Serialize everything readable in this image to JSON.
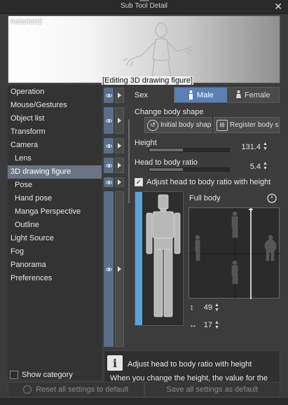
{
  "window": {
    "title": "Sub Tool Detail",
    "close_icon": "close-icon"
  },
  "preview": {
    "name": "Astarion2",
    "editing_label": "[Editing 3D drawing figure]"
  },
  "categories": [
    {
      "label": "Operation",
      "sub": false,
      "selected": false
    },
    {
      "label": "Mouse/Gestures",
      "sub": false,
      "selected": false
    },
    {
      "label": "Object list",
      "sub": false,
      "selected": false
    },
    {
      "label": "Transform",
      "sub": false,
      "selected": false
    },
    {
      "label": "Camera",
      "sub": false,
      "selected": false
    },
    {
      "label": "Lens",
      "sub": true,
      "selected": false
    },
    {
      "label": "3D drawing figure",
      "sub": false,
      "selected": true
    },
    {
      "label": "Pose",
      "sub": true,
      "selected": false
    },
    {
      "label": "Hand pose",
      "sub": true,
      "selected": false
    },
    {
      "label": "Manga Perspective",
      "sub": true,
      "selected": false
    },
    {
      "label": "Outline",
      "sub": true,
      "selected": false
    },
    {
      "label": "Light Source",
      "sub": false,
      "selected": false
    },
    {
      "label": "Fog",
      "sub": false,
      "selected": false
    },
    {
      "label": "Panorama",
      "sub": false,
      "selected": false
    },
    {
      "label": "Preferences",
      "sub": false,
      "selected": false
    }
  ],
  "show_category": {
    "label": "Show category",
    "checked": false
  },
  "sex": {
    "label": "Sex",
    "male": "Male",
    "female": "Female",
    "selected": "Male"
  },
  "body_shape": {
    "label": "Change body shape",
    "initial_button": "Initial body shape",
    "register_button": "Register body shape"
  },
  "height": {
    "label": "Height",
    "value": "131.4",
    "level": 0.42
  },
  "head_ratio": {
    "label": "Head to body ratio",
    "value": "5.4",
    "level": 0.42
  },
  "adjust": {
    "label": "Adjust head to body ratio with height",
    "checked": true
  },
  "full_body": {
    "label": "Full body",
    "reset_icon": "reset-icon"
  },
  "grid_values": {
    "vertical": "49",
    "horizontal": "17"
  },
  "help": {
    "title": "Adjust head to body ratio with height",
    "text": "When you change the height, the value for the"
  },
  "footer": {
    "reset_label": "Reset all settings to default",
    "save_label": "Save all settings as default"
  },
  "colors": {
    "accent": "#5b7fb3",
    "selected_category": "#6a7485",
    "body_bar": "#5ea2d6",
    "gutter": "#5a6e8a"
  }
}
